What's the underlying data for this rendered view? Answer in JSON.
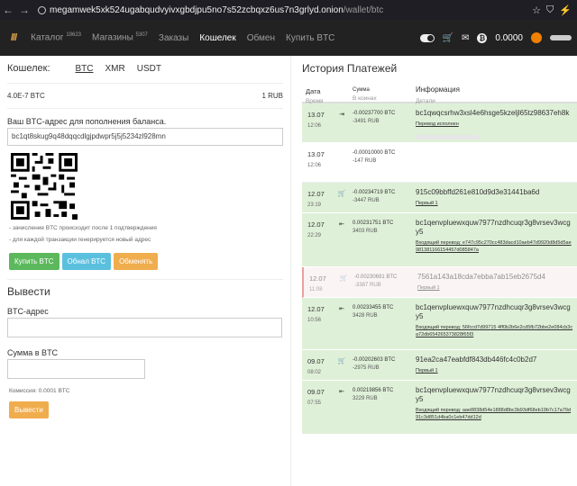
{
  "browser": {
    "url_host": "megamwek5xk524ugabqudvyivxgbdjpu5no7s52zcbqxz6us7n3grlyd.onion",
    "url_path": "/wallet/btc"
  },
  "nav": {
    "logo": "///",
    "items": [
      {
        "label": "Каталог",
        "count": "19623"
      },
      {
        "label": "Магазины",
        "count": "5307"
      },
      {
        "label": "Заказы",
        "count": ""
      },
      {
        "label": "Кошелек",
        "count": ""
      },
      {
        "label": "Обмен",
        "count": ""
      },
      {
        "label": "Купить BTC",
        "count": ""
      }
    ],
    "balance": "0.0000"
  },
  "wallet": {
    "title": "Кошелек:",
    "tabs": [
      "BTC",
      "XMR",
      "USDT"
    ],
    "rate_btc": "4.0E-7 BTC",
    "rate_rub": "1 RUB",
    "address_label": "Ваш BTC-адрес для пополнения баланса.",
    "address": "bc1qt8skug9q48dqqcdlgjpdwpr5j5j5234zl928mn",
    "notes": [
      "- зачисление BTC происходит после 1 подтверждения",
      "- для каждой транзакции генерируется новый адрес"
    ],
    "buttons": {
      "buy": "Купить BTC",
      "refresh": "Обнал BTC",
      "exchange": "Обменять"
    }
  },
  "withdraw": {
    "title": "Вывести",
    "address_label": "BTC-адрес",
    "amount_label": "Сумма в BTC",
    "commission": "Комиссия: 0.0001 BTC",
    "button": "Вывести"
  },
  "history": {
    "title": "История Платежей",
    "headers": {
      "date": "Дата",
      "date_sub": "Время",
      "sum": "Сумма",
      "sum_sub": "В коинах",
      "info": "Информация",
      "info_sub": "Детали"
    },
    "rows": [
      {
        "date": "13.07",
        "time": "12:06",
        "icon": "⇥",
        "btc": "-0.00237700 BTC",
        "rub": "-3491 RUB",
        "info": "bc1qwqcsrhw3xsl4e6hsge5kzeljl65tz98637eh8k",
        "detail": "Перевод исполнен",
        "style": "green-row"
      },
      {
        "date": "13.07",
        "time": "12:06",
        "icon": "",
        "btc": "-0.00010000 BTC",
        "rub": "-147 RUB",
        "info": "",
        "detail": "",
        "style": "white-row"
      },
      {
        "date": "12.07",
        "time": "23:19",
        "icon": "🛒",
        "btc": "-0.00234719 BTC",
        "rub": "-3447 RUB",
        "info": "915c09bbffd261e810d9d3e31441ba6d",
        "detail": "Первый 1",
        "style": "green-row"
      },
      {
        "date": "12.07",
        "time": "22:29",
        "icon": "⇤",
        "btc": "0.00231751 BTC",
        "rub": "3403 RUB",
        "info": "bc1qenvpluewxquw7977nzdhcuqr3g8vrsev3wcgy5",
        "detail": "Входящий перевод: e747c95c270cc483dacd10aeb47d9920d8d5d5ae981381166154457d085847a",
        "style": "green-row"
      },
      {
        "date": "12.07",
        "time": "11:08",
        "icon": "🛒",
        "btc": "-0.00230691 BTC",
        "rub": "-3387 RUB",
        "info": "7561a143a18cda7ebba7ab15eb2675d4",
        "detail": "Первый 1",
        "style": "red-row"
      },
      {
        "date": "12.07",
        "time": "10:56",
        "icon": "⇤",
        "btc": "0.00233455 BTC",
        "rub": "3428 RUB",
        "info": "bc1qenvpluewxquw7977nzdhcuqr3g8vrsev3wcgy5",
        "detail": "Входящий перевод: 56fccd7d99715 4ff0b2b6e2cd5fb72bbe2e084cb3ca72db654265373828f65f3",
        "style": "green-row"
      },
      {
        "date": "09.07",
        "time": "08:02",
        "icon": "🛒",
        "btc": "-0.00202603 BTC",
        "rub": "-2975 RUB",
        "info": "91ea2ca47eabfdf843db446fc4c0b2d7",
        "detail": "Первый 1",
        "style": "green-row"
      },
      {
        "date": "09.07",
        "time": "07:55",
        "icon": "⇤",
        "btc": "0.00219856 BTC",
        "rub": "3229 RUB",
        "info": "bc1qenvpluewxquw7977nzdhcuqr3g8vrsev3wcgy5",
        "detail": "Входящий перевод: aae8838d54e1888d8bc3b93df68eb19b7c17a79d91c3d851d4ba0c1eb47dd12d",
        "style": "green-row"
      }
    ]
  }
}
